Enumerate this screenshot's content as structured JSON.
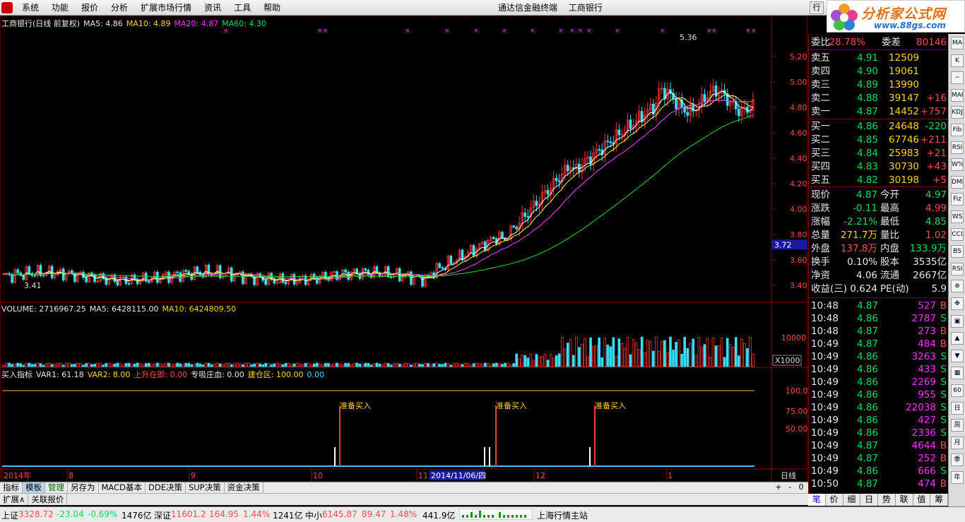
{
  "menu": {
    "items": [
      "系统",
      "功能",
      "报价",
      "分析",
      "扩展市场行情",
      "资讯",
      "工具",
      "帮助"
    ],
    "title_app": "通达信金融终端",
    "title_stock": "工商银行",
    "window_label": "行"
  },
  "brand": {
    "name": "分析家公式网",
    "url": "www.88gs.com"
  },
  "price_chart": {
    "header": {
      "name": "工商银行(日线 前复权)",
      "ma5": "MA5: 4.86",
      "ma10": "MA10: 4.89",
      "ma20": "MA20: 4.87",
      "ma60": "MA60: 4.30"
    },
    "y_ticks": [
      "5.20",
      "5.00",
      "4.80",
      "4.60",
      "4.40",
      "4.20",
      "4.00",
      "3.80",
      "3.60",
      "3.40"
    ],
    "current_label": "3.72",
    "high_label": "5.36",
    "low_label": "3.41",
    "colors": {
      "up": "#ff3333",
      "down": "#35e0ff",
      "ma5": "#ffffff",
      "ma10": "#ffff33",
      "ma20": "#ff44ff",
      "ma60": "#22dd22",
      "marker": "#ff33ff"
    }
  },
  "volume_chart": {
    "header": {
      "volume": "VOLUME: 2716967.25",
      "ma5": "MA5: 6428115.00",
      "ma10": "MA10: 6424809.50"
    },
    "y_ticks": [
      "10000"
    ],
    "unit_label": "X1000"
  },
  "indicator_chart": {
    "header": {
      "name": "买入指标",
      "var1": "VAR1: 61.18",
      "var2": "VAR2: 8.00",
      "rise": "上升在即: 0.00",
      "absorb": "专吸庄血: 0.00",
      "build": "建仓区: 100.00",
      "extra": "0.00"
    },
    "y_ticks": [
      "100.0",
      "75.00",
      "50.00"
    ],
    "signal_label": "准备买入"
  },
  "x_axis": {
    "labels": [
      "2014年",
      "8",
      "9",
      "10",
      "11",
      "12",
      "1"
    ],
    "cursor_date": "2014/11/06/四",
    "period": "日线"
  },
  "quote": {
    "order_ratio": {
      "label1": "委比",
      "value1": "28.78%",
      "label2": "委差",
      "value2": "80146"
    },
    "asks": [
      {
        "label": "卖五",
        "price": "4.91",
        "vol": "12509",
        "chg": ""
      },
      {
        "label": "卖四",
        "price": "4.90",
        "vol": "19061",
        "chg": ""
      },
      {
        "label": "卖三",
        "price": "4.89",
        "vol": "13990",
        "chg": ""
      },
      {
        "label": "卖二",
        "price": "4.88",
        "vol": "39147",
        "chg": "+16"
      },
      {
        "label": "卖一",
        "price": "4.87",
        "vol": "14452",
        "chg": "+757"
      }
    ],
    "bids": [
      {
        "label": "买一",
        "price": "4.86",
        "vol": "24648",
        "chg": "-220"
      },
      {
        "label": "买二",
        "price": "4.85",
        "vol": "67746",
        "chg": "+211"
      },
      {
        "label": "买三",
        "price": "4.84",
        "vol": "25983",
        "chg": "+21"
      },
      {
        "label": "买四",
        "price": "4.83",
        "vol": "30730",
        "chg": "+43"
      },
      {
        "label": "买五",
        "price": "4.82",
        "vol": "30198",
        "chg": "+5"
      }
    ],
    "stats": [
      {
        "l1": "现价",
        "v1": "4.87",
        "c1": "green",
        "l2": "今开",
        "v2": "4.97",
        "c2": "green"
      },
      {
        "l1": "涨跌",
        "v1": "-0.11",
        "c1": "green",
        "l2": "最高",
        "v2": "4.99",
        "c2": "red"
      },
      {
        "l1": "涨幅",
        "v1": "-2.21%",
        "c1": "green",
        "l2": "最低",
        "v2": "4.85",
        "c2": "green"
      },
      {
        "l1": "总量",
        "v1": "271.7万",
        "c1": "yellow",
        "l2": "量比",
        "v2": "1.02",
        "c2": "red"
      },
      {
        "l1": "外盘",
        "v1": "137.8万",
        "c1": "red",
        "l2": "内盘",
        "v2": "133.9万",
        "c2": "green"
      },
      {
        "l1": "换手",
        "v1": "0.10%",
        "c1": "white",
        "l2": "股本",
        "v2": "3535亿",
        "c2": "white"
      },
      {
        "l1": "净资",
        "v1": "4.06",
        "c1": "white",
        "l2": "流通",
        "v2": "2667亿",
        "c2": "white"
      },
      {
        "l1": "收益(三)",
        "v1": "0.624",
        "c1": "white",
        "l2": "PE(动)",
        "v2": "5.9",
        "c2": "white"
      }
    ],
    "ticks": [
      {
        "t": "10:48",
        "p": "4.87",
        "v": "527",
        "d": "B"
      },
      {
        "t": "10:48",
        "p": "4.86",
        "v": "2787",
        "d": "S"
      },
      {
        "t": "10:48",
        "p": "4.87",
        "v": "273",
        "d": "B"
      },
      {
        "t": "10:49",
        "p": "4.87",
        "v": "484",
        "d": "B"
      },
      {
        "t": "10:49",
        "p": "4.86",
        "v": "3263",
        "d": "S"
      },
      {
        "t": "10:49",
        "p": "4.86",
        "v": "433",
        "d": "S"
      },
      {
        "t": "10:49",
        "p": "4.86",
        "v": "2269",
        "d": "S"
      },
      {
        "t": "10:49",
        "p": "4.86",
        "v": "955",
        "d": "S"
      },
      {
        "t": "10:49",
        "p": "4.86",
        "v": "22038",
        "d": "S"
      },
      {
        "t": "10:49",
        "p": "4.86",
        "v": "427",
        "d": "S"
      },
      {
        "t": "10:49",
        "p": "4.86",
        "v": "2336",
        "d": "S"
      },
      {
        "t": "10:49",
        "p": "4.87",
        "v": "4644",
        "d": "B"
      },
      {
        "t": "10:49",
        "p": "4.87",
        "v": "252",
        "d": "B"
      },
      {
        "t": "10:49",
        "p": "4.86",
        "v": "666",
        "d": "S"
      },
      {
        "t": "10:50",
        "p": "4.87",
        "v": "474",
        "d": "B"
      }
    ]
  },
  "right_tabs": [
    "笔",
    "价",
    "细",
    "日",
    "势",
    "联",
    "值",
    "筹"
  ],
  "toolbar_icons": [
    "ma-icon",
    "bar-icon",
    "line-icon",
    "macd-icon",
    "kdj-icon",
    "fib-icon",
    "rsi-icon",
    "wr-icon",
    "dmi-icon",
    "fiz-icon",
    "ws-icon",
    "cci-icon",
    "bs-icon",
    "rs-icon",
    "zoom-icon",
    "move-icon",
    "win-icon",
    "arrow-up-icon",
    "arrow-down-icon",
    "grid-icon",
    "sixty-icon",
    "day-icon",
    "week-icon",
    "month-icon",
    "quarter-icon",
    "year-icon"
  ],
  "toolbar_labels": [
    "MA",
    "K",
    "~",
    "MACD",
    "KDJ",
    "Fib",
    "RSI",
    "W%",
    "DMI",
    "Fiz",
    "WS",
    "CCI",
    "BS",
    "RSI",
    "⊕",
    "✥",
    "▣",
    "▲",
    "▼",
    "▦",
    "60",
    "日",
    "周",
    "月",
    "季",
    "年"
  ],
  "tabbar": [
    "指标",
    "模板",
    "管理",
    "另存为",
    "MACD基本",
    "DDE决策",
    "SUP决策",
    "资金决策"
  ],
  "tabbar2": [
    "扩展∧",
    "关联报价"
  ],
  "chart_controls": [
    "+",
    "-",
    "0"
  ],
  "status": {
    "sh_label": "上证",
    "sh_val": "3328.72",
    "sh_chg": "-23.04",
    "sh_pct": "-0.69%",
    "sh_amt": "1476亿",
    "sz_label": "深证",
    "sz_val": "11601.2",
    "sz_chg": "164.95",
    "sz_pct": "1.44%",
    "sz_amt": "1241亿",
    "zx_label": "中小",
    "zx_val": "6145.87",
    "zx_chg": "89.47",
    "zx_pct": "1.48%",
    "zx_amt": "441.9亿",
    "server": "上海行情主站"
  }
}
